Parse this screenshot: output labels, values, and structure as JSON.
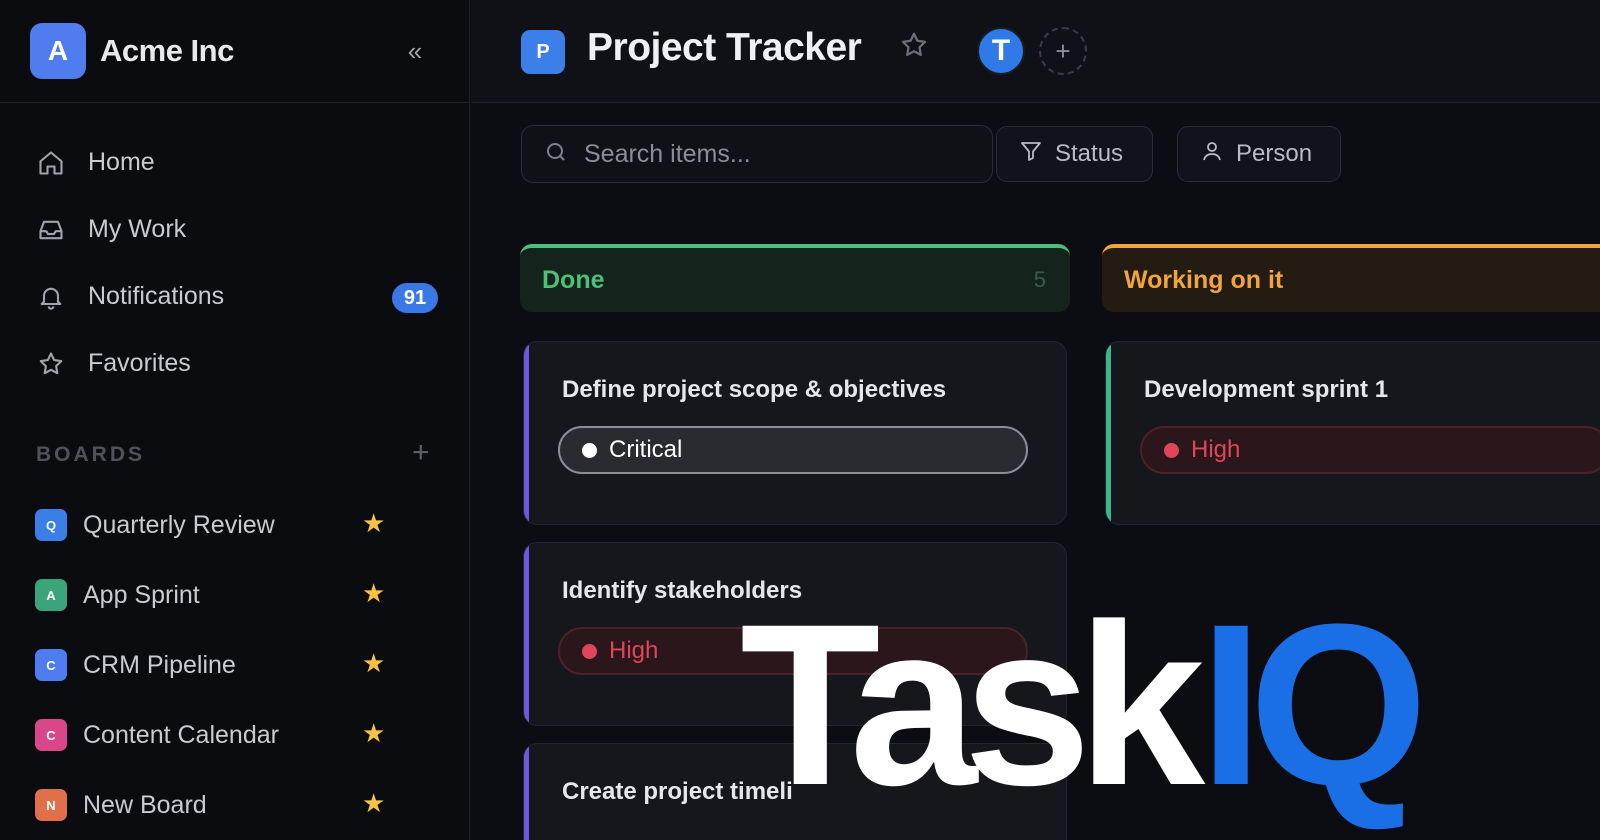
{
  "workspace": {
    "logo_letter": "A",
    "name": "Acme Inc",
    "collapse_glyph": "«"
  },
  "nav": {
    "items": [
      {
        "label": "Home",
        "icon": "home-icon"
      },
      {
        "label": "My Work",
        "icon": "inbox-icon"
      },
      {
        "label": "Notifications",
        "icon": "bell-icon",
        "badge": "91"
      },
      {
        "label": "Favorites",
        "icon": "star-icon"
      }
    ]
  },
  "boards": {
    "title": "BOARDS",
    "add_glyph": "+",
    "items": [
      {
        "letter": "Q",
        "label": "Quarterly Review",
        "color": "#3a7ee8"
      },
      {
        "letter": "A",
        "label": "App Sprint",
        "color": "#3aa57a"
      },
      {
        "letter": "C",
        "label": "CRM Pipeline",
        "color": "#4f7df0"
      },
      {
        "letter": "C",
        "label": "Content Calendar",
        "color": "#d9468a"
      },
      {
        "letter": "N",
        "label": "New Board",
        "color": "#e0704a"
      }
    ],
    "favorite_glyph": "★"
  },
  "header": {
    "project_letter": "P",
    "project_title": "Project Tracker",
    "avatar_letter": "T",
    "add_glyph": "+"
  },
  "toolbar": {
    "search_placeholder": "Search items...",
    "status_label": "Status",
    "person_label": "Person"
  },
  "columns": [
    {
      "label": "Done",
      "count": "5",
      "color": "#4cc07a",
      "bg": "#14241c",
      "cards": [
        {
          "title": "Define project scope & objectives",
          "priority": "Critical",
          "accent": "#6a5ae0"
        },
        {
          "title": "Identify stakeholders",
          "priority": "High",
          "accent": "#6a5ae0"
        },
        {
          "title": "Create project timeli",
          "priority": "",
          "accent": "#6a5ae0"
        }
      ]
    },
    {
      "label": "Working on it",
      "count": "",
      "color": "#f0a63d",
      "bg": "#241c12",
      "cards": [
        {
          "title": "Development sprint 1",
          "priority": "High",
          "accent": "#3fb58a"
        }
      ]
    }
  ],
  "brand": {
    "part1": "Task",
    "part2": "IQ"
  },
  "colors": {
    "accent": "#3a78e6",
    "critical": "#ffffff",
    "high": "#e0455a"
  }
}
